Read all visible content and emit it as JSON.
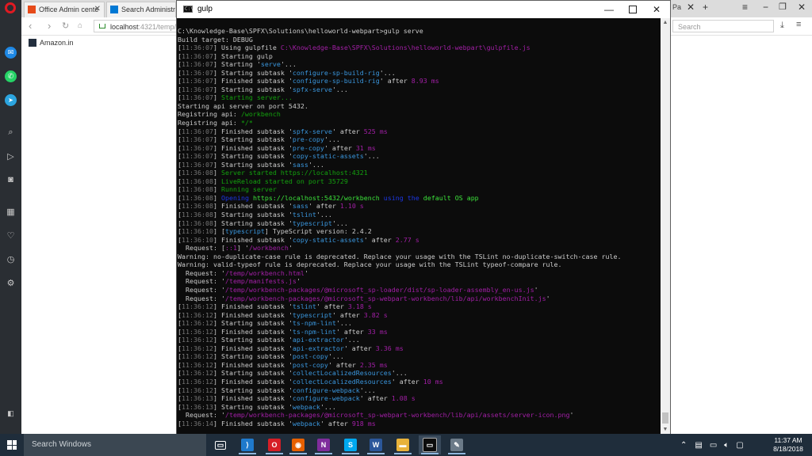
{
  "browser": {
    "tabs": [
      {
        "label": "Office Admin cente",
        "fav_color": "#e64a19"
      },
      {
        "label": "Search Administrati",
        "fav_color": "#0078d4"
      }
    ],
    "url_host": "localhost",
    "url_rest": ":4321/temp/",
    "search_placeholder": "Search",
    "bookmark": "Amazon.in",
    "right_tab": "Pa"
  },
  "sidebar": {
    "icons": [
      "opera-logo",
      "messenger-icon",
      "whatsapp-icon",
      "telegram-icon",
      "search-icon",
      "send-icon",
      "camera-icon",
      "apps-icon",
      "heart-icon",
      "history-icon",
      "settings-icon",
      "sidebar-toggle-icon"
    ]
  },
  "terminal": {
    "title": "gulp",
    "icon_text": "C:\\",
    "lines": [
      [
        [
          "C:\\Knowledge-Base\\SPFX\\Solutions\\helloworld-webpart>gulp serve",
          "w"
        ]
      ],
      [
        [
          "Build target: DEBUG",
          "w"
        ]
      ],
      [
        [
          "[",
          "w"
        ],
        [
          "11:36:07",
          "g"
        ],
        [
          "] Using gulpfile ",
          "w"
        ],
        [
          "C:\\Knowledge-Base\\SPFX\\Solutions\\helloworld-webpart\\gulpfile.js",
          "m"
        ]
      ],
      [
        [
          "[",
          "w"
        ],
        [
          "11:36:07",
          "g"
        ],
        [
          "] Starting gulp",
          "w"
        ]
      ],
      [
        [
          "[",
          "w"
        ],
        [
          "11:36:07",
          "g"
        ],
        [
          "] Starting '",
          "w"
        ],
        [
          "serve",
          "c"
        ],
        [
          "'...",
          "w"
        ]
      ],
      [
        [
          "[",
          "w"
        ],
        [
          "11:36:07",
          "g"
        ],
        [
          "] Starting subtask '",
          "w"
        ],
        [
          "configure-sp-build-rig",
          "c"
        ],
        [
          "'...",
          "w"
        ]
      ],
      [
        [
          "[",
          "w"
        ],
        [
          "11:36:07",
          "g"
        ],
        [
          "] Finished subtask '",
          "w"
        ],
        [
          "configure-sp-build-rig",
          "c"
        ],
        [
          "' after ",
          "w"
        ],
        [
          "8.93 ms",
          "m"
        ]
      ],
      [
        [
          "[",
          "w"
        ],
        [
          "11:36:07",
          "g"
        ],
        [
          "] Starting subtask '",
          "w"
        ],
        [
          "spfx-serve",
          "c"
        ],
        [
          "'...",
          "w"
        ]
      ],
      [
        [
          "[",
          "w"
        ],
        [
          "11:36:07",
          "g"
        ],
        [
          "] ",
          "w"
        ],
        [
          "Starting server...",
          "gr"
        ]
      ],
      [
        [
          "Starting api server on port 5432.",
          "w"
        ]
      ],
      [
        [
          "Registring api: ",
          "w"
        ],
        [
          "/workbench",
          "gr"
        ]
      ],
      [
        [
          "Registring api: ",
          "w"
        ],
        [
          "*/*",
          "gr"
        ]
      ],
      [
        [
          "[",
          "w"
        ],
        [
          "11:36:07",
          "g"
        ],
        [
          "] Finished subtask '",
          "w"
        ],
        [
          "spfx-serve",
          "c"
        ],
        [
          "' after ",
          "w"
        ],
        [
          "525 ms",
          "m"
        ]
      ],
      [
        [
          "[",
          "w"
        ],
        [
          "11:36:07",
          "g"
        ],
        [
          "] Starting subtask '",
          "w"
        ],
        [
          "pre-copy",
          "c"
        ],
        [
          "'...",
          "w"
        ]
      ],
      [
        [
          "[",
          "w"
        ],
        [
          "11:36:07",
          "g"
        ],
        [
          "] Finished subtask '",
          "w"
        ],
        [
          "pre-copy",
          "c"
        ],
        [
          "' after ",
          "w"
        ],
        [
          "31 ms",
          "m"
        ]
      ],
      [
        [
          "[",
          "w"
        ],
        [
          "11:36:07",
          "g"
        ],
        [
          "] Starting subtask '",
          "w"
        ],
        [
          "copy-static-assets",
          "c"
        ],
        [
          "'...",
          "w"
        ]
      ],
      [
        [
          "[",
          "w"
        ],
        [
          "11:36:07",
          "g"
        ],
        [
          "] Starting subtask '",
          "w"
        ],
        [
          "sass",
          "c"
        ],
        [
          "'...",
          "w"
        ]
      ],
      [
        [
          "[",
          "w"
        ],
        [
          "11:36:08",
          "g"
        ],
        [
          "] ",
          "w"
        ],
        [
          "Server started https://localhost:4321",
          "gr"
        ]
      ],
      [
        [
          "[",
          "w"
        ],
        [
          "11:36:08",
          "g"
        ],
        [
          "] ",
          "w"
        ],
        [
          "LiveReload started on port 35729",
          "gr"
        ]
      ],
      [
        [
          "[",
          "w"
        ],
        [
          "11:36:08",
          "g"
        ],
        [
          "] ",
          "w"
        ],
        [
          "Running server",
          "gr"
        ]
      ],
      [
        [
          "[",
          "w"
        ],
        [
          "11:36:08",
          "g"
        ],
        [
          "] ",
          "w"
        ],
        [
          "Opening ",
          "b"
        ],
        [
          "https://localhost:5432/workbench",
          "bg"
        ],
        [
          " using the ",
          "b"
        ],
        [
          "default OS app",
          "bg"
        ]
      ],
      [
        [
          "[",
          "w"
        ],
        [
          "11:36:08",
          "g"
        ],
        [
          "] Finished subtask '",
          "w"
        ],
        [
          "sass",
          "c"
        ],
        [
          "' after ",
          "w"
        ],
        [
          "1.10 s",
          "m"
        ]
      ],
      [
        [
          "[",
          "w"
        ],
        [
          "11:36:08",
          "g"
        ],
        [
          "] Starting subtask '",
          "w"
        ],
        [
          "tslint",
          "c"
        ],
        [
          "'...",
          "w"
        ]
      ],
      [
        [
          "[",
          "w"
        ],
        [
          "11:36:08",
          "g"
        ],
        [
          "] Starting subtask '",
          "w"
        ],
        [
          "typescript",
          "c"
        ],
        [
          "'...",
          "w"
        ]
      ],
      [
        [
          "[",
          "w"
        ],
        [
          "11:36:10",
          "g"
        ],
        [
          "] [",
          "w"
        ],
        [
          "typescript",
          "c"
        ],
        [
          "] TypeScript version: 2.4.2",
          "w"
        ]
      ],
      [
        [
          "[",
          "w"
        ],
        [
          "11:36:10",
          "g"
        ],
        [
          "] Finished subtask '",
          "w"
        ],
        [
          "copy-static-assets",
          "c"
        ],
        [
          "' after ",
          "w"
        ],
        [
          "2.77 s",
          "m"
        ]
      ],
      [
        [
          "  Request: [",
          "w"
        ],
        [
          "::1",
          "m"
        ],
        [
          "] '",
          "w"
        ],
        [
          "/workbench",
          "m"
        ],
        [
          "'",
          "w"
        ]
      ],
      [
        [
          "Warning: no-duplicate-case rule is deprecated. Replace your usage with the TSLint no-duplicate-switch-case rule.",
          "w"
        ]
      ],
      [
        [
          "Warning: valid-typeof rule is deprecated. Replace your usage with the TSLint typeof-compare rule.",
          "w"
        ]
      ],
      [
        [
          "  Request: '",
          "w"
        ],
        [
          "/temp/workbench.html",
          "m"
        ],
        [
          "'",
          "w"
        ]
      ],
      [
        [
          "  Request: '",
          "w"
        ],
        [
          "/temp/manifests.js",
          "m"
        ],
        [
          "'",
          "w"
        ]
      ],
      [
        [
          "  Request: '",
          "w"
        ],
        [
          "/temp/workbench-packages/@microsoft_sp-loader/dist/sp-loader-assembly_en-us.js",
          "m"
        ],
        [
          "'",
          "w"
        ]
      ],
      [
        [
          "  Request: '",
          "w"
        ],
        [
          "/temp/workbench-packages/@microsoft_sp-webpart-workbench/lib/api/workbenchInit.js",
          "m"
        ],
        [
          "'",
          "w"
        ]
      ],
      [
        [
          "[",
          "w"
        ],
        [
          "11:36:12",
          "g"
        ],
        [
          "] Finished subtask '",
          "w"
        ],
        [
          "tslint",
          "c"
        ],
        [
          "' after ",
          "w"
        ],
        [
          "3.18 s",
          "m"
        ]
      ],
      [
        [
          "[",
          "w"
        ],
        [
          "11:36:12",
          "g"
        ],
        [
          "] Finished subtask '",
          "w"
        ],
        [
          "typescript",
          "c"
        ],
        [
          "' after ",
          "w"
        ],
        [
          "3.82 s",
          "m"
        ]
      ],
      [
        [
          "[",
          "w"
        ],
        [
          "11:36:12",
          "g"
        ],
        [
          "] Starting subtask '",
          "w"
        ],
        [
          "ts-npm-lint",
          "c"
        ],
        [
          "'...",
          "w"
        ]
      ],
      [
        [
          "[",
          "w"
        ],
        [
          "11:36:12",
          "g"
        ],
        [
          "] Finished subtask '",
          "w"
        ],
        [
          "ts-npm-lint",
          "c"
        ],
        [
          "' after ",
          "w"
        ],
        [
          "33 ms",
          "m"
        ]
      ],
      [
        [
          "[",
          "w"
        ],
        [
          "11:36:12",
          "g"
        ],
        [
          "] Starting subtask '",
          "w"
        ],
        [
          "api-extractor",
          "c"
        ],
        [
          "'...",
          "w"
        ]
      ],
      [
        [
          "[",
          "w"
        ],
        [
          "11:36:12",
          "g"
        ],
        [
          "] Finished subtask '",
          "w"
        ],
        [
          "api-extractor",
          "c"
        ],
        [
          "' after ",
          "w"
        ],
        [
          "3.36 ms",
          "m"
        ]
      ],
      [
        [
          "[",
          "w"
        ],
        [
          "11:36:12",
          "g"
        ],
        [
          "] Starting subtask '",
          "w"
        ],
        [
          "post-copy",
          "c"
        ],
        [
          "'...",
          "w"
        ]
      ],
      [
        [
          "[",
          "w"
        ],
        [
          "11:36:12",
          "g"
        ],
        [
          "] Finished subtask '",
          "w"
        ],
        [
          "post-copy",
          "c"
        ],
        [
          "' after ",
          "w"
        ],
        [
          "2.35 ms",
          "m"
        ]
      ],
      [
        [
          "[",
          "w"
        ],
        [
          "11:36:12",
          "g"
        ],
        [
          "] Starting subtask '",
          "w"
        ],
        [
          "collectLocalizedResources",
          "c"
        ],
        [
          "'...",
          "w"
        ]
      ],
      [
        [
          "[",
          "w"
        ],
        [
          "11:36:12",
          "g"
        ],
        [
          "] Finished subtask '",
          "w"
        ],
        [
          "collectLocalizedResources",
          "c"
        ],
        [
          "' after ",
          "w"
        ],
        [
          "10 ms",
          "m"
        ]
      ],
      [
        [
          "[",
          "w"
        ],
        [
          "11:36:12",
          "g"
        ],
        [
          "] Starting subtask '",
          "w"
        ],
        [
          "configure-webpack",
          "c"
        ],
        [
          "'...",
          "w"
        ]
      ],
      [
        [
          "[",
          "w"
        ],
        [
          "11:36:13",
          "g"
        ],
        [
          "] Finished subtask '",
          "w"
        ],
        [
          "configure-webpack",
          "c"
        ],
        [
          "' after ",
          "w"
        ],
        [
          "1.08 s",
          "m"
        ]
      ],
      [
        [
          "[",
          "w"
        ],
        [
          "11:36:13",
          "g"
        ],
        [
          "] Starting subtask '",
          "w"
        ],
        [
          "webpack",
          "c"
        ],
        [
          "'...",
          "w"
        ]
      ],
      [
        [
          "  Request: '",
          "w"
        ],
        [
          "/temp/workbench-packages/@microsoft_sp-webpart-workbench/lib/api/assets/server-icon.png",
          "m"
        ],
        [
          "'",
          "w"
        ]
      ],
      [
        [
          "[",
          "w"
        ],
        [
          "11:36:14",
          "g"
        ],
        [
          "] Finished subtask '",
          "w"
        ],
        [
          "webpack",
          "c"
        ],
        [
          "' after ",
          "w"
        ],
        [
          "918 ms",
          "m"
        ]
      ]
    ]
  },
  "taskbar": {
    "search_placeholder": "Search Windows",
    "apps": [
      {
        "name": "task-view-button",
        "glyph": "▭",
        "color": "transparent"
      },
      {
        "name": "vscode-app",
        "glyph": "⟩",
        "color": "#1f7acd"
      },
      {
        "name": "opera-app",
        "glyph": "O",
        "color": "#d61e26"
      },
      {
        "name": "firefox-app",
        "glyph": "◉",
        "color": "#e66000"
      },
      {
        "name": "onenote-app",
        "glyph": "N",
        "color": "#7f2c9c"
      },
      {
        "name": "skype-app",
        "glyph": "S",
        "color": "#00a9f0"
      },
      {
        "name": "word-app",
        "glyph": "W",
        "color": "#2b579a"
      },
      {
        "name": "explorer-app",
        "glyph": "▬",
        "color": "#e8b23a"
      },
      {
        "name": "terminal-app",
        "glyph": "▭",
        "color": "#0c0c0c"
      },
      {
        "name": "settings-app",
        "glyph": "✎",
        "color": "#6b7a88"
      }
    ],
    "time": "11:37 AM",
    "date": "8/18/2018"
  },
  "colors": {
    "w": "#cccccc",
    "g": "#767676",
    "m": "#a21fa6",
    "c": "#3a96dd",
    "gr": "#13a10e",
    "b": "#1c37e6",
    "bg": "#3ce23a"
  }
}
